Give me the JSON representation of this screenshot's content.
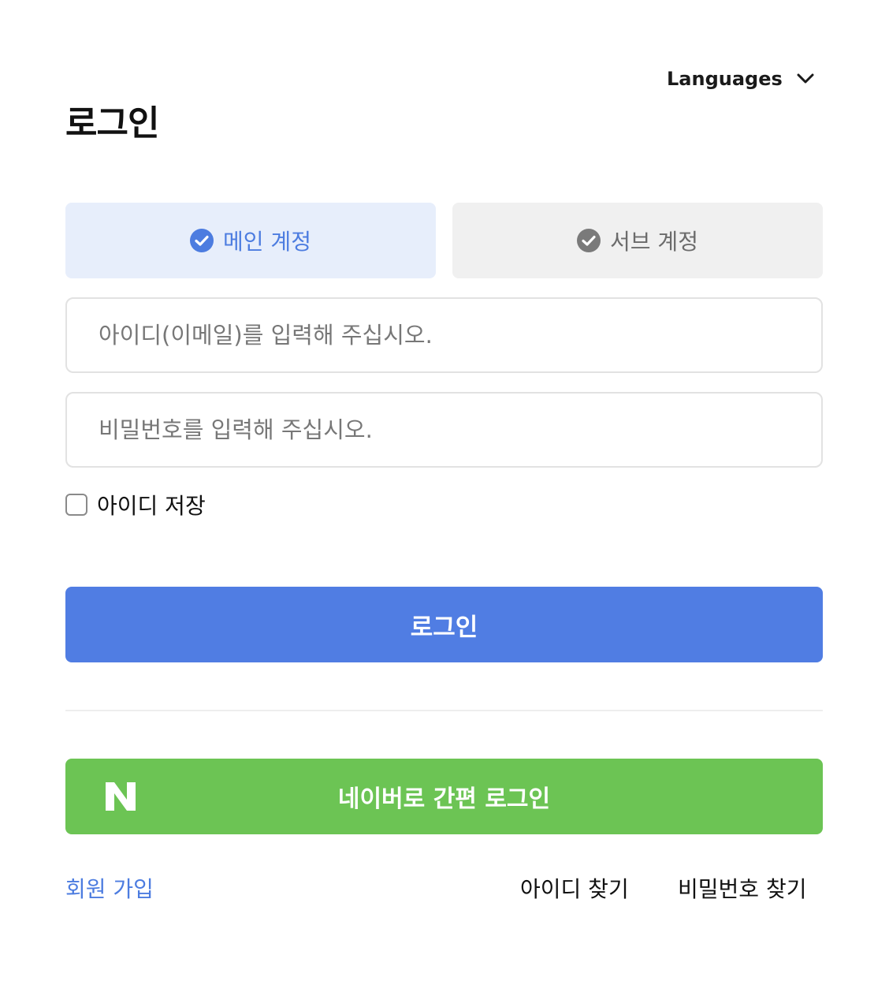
{
  "header": {
    "title": "로그인",
    "language_label": "Languages",
    "language_icon": "chevron-down-icon"
  },
  "account_tabs": [
    {
      "label": "메인 계정",
      "icon": "check-circle-icon",
      "selected": true
    },
    {
      "label": "서브 계정",
      "icon": "check-circle-icon",
      "selected": false
    }
  ],
  "form": {
    "id_placeholder": "아이디(이메일)를 입력해 주십시오.",
    "id_value": "",
    "password_placeholder": "비밀번호를 입력해 주십시오.",
    "password_value": "",
    "remember_label": "아이디 저장",
    "remember_checked": false,
    "login_label": "로그인"
  },
  "naver": {
    "label": "네이버로 간편 로그인",
    "logo_letter": "N"
  },
  "footer": {
    "signup": "회원 가입",
    "find_id": "아이디 찾기",
    "find_password": "비밀번호 찾기"
  },
  "colors": {
    "primary": "#507de3",
    "primary_text": "#4c7ce0",
    "active_tab_bg": "#e7eefb",
    "inactive_tab_bg": "#f0f0f0",
    "naver_green": "#6cc454"
  }
}
